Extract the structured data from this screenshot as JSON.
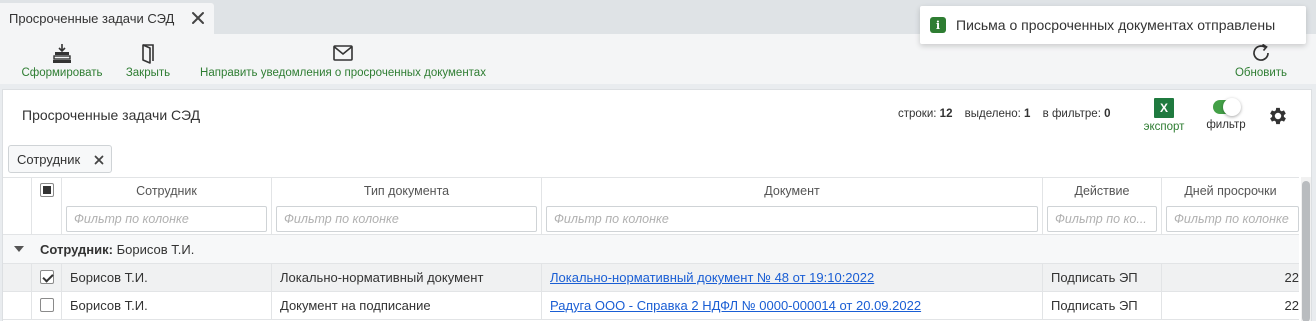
{
  "tab": {
    "title": "Просроченные задачи СЭД"
  },
  "toolbar": {
    "generate_label": "Сформировать",
    "close_label": "Закрыть",
    "notify_label": "Направить уведомления о просроченных документах",
    "refresh_label": "Обновить"
  },
  "toast": {
    "message": "Письма о просроченных документах отправлены"
  },
  "panel": {
    "title": "Просроченные задачи СЭД",
    "stats": {
      "rows_label": "строки:",
      "rows_value": "12",
      "selected_label": "выделено:",
      "selected_value": "1",
      "filtered_label": "в фильтре:",
      "filtered_value": "0"
    },
    "export_label": "экспорт",
    "export_icon_text": "X",
    "filter_label": "фильтр",
    "filter_on": true
  },
  "group_chip": {
    "label": "Сотрудник"
  },
  "grid": {
    "columns": [
      {
        "title": "Сотрудник",
        "filter_placeholder": "Фильтр по колонке"
      },
      {
        "title": "Тип документа",
        "filter_placeholder": "Фильтр по колонке"
      },
      {
        "title": "Документ",
        "filter_placeholder": "Фильтр по колонке"
      },
      {
        "title": "Действие",
        "filter_placeholder": "Фильтр по ко..."
      },
      {
        "title": "Дней просрочки",
        "filter_placeholder": "Фильтр по колонке"
      }
    ],
    "group": {
      "label": "Сотрудник:",
      "value": "Борисов Т.И."
    },
    "rows": [
      {
        "checked": true,
        "employee": "Борисов Т.И.",
        "doc_type": "Локально-нормативный документ",
        "document": "Локально-нормативный документ № 48 от 19:10:2022",
        "action": "Подписать ЭП",
        "days": "22"
      },
      {
        "checked": false,
        "employee": "Борисов Т.И.",
        "doc_type": "Документ на подписание",
        "document": "Радуга ООО - Справка 2 НДФЛ № 0000-000014 от 20.09.2022",
        "action": "Подписать ЭП",
        "days": "22"
      }
    ]
  },
  "colors": {
    "accent": "#2e7d32",
    "link": "#1a5ed4",
    "toggle": "#43a047"
  }
}
